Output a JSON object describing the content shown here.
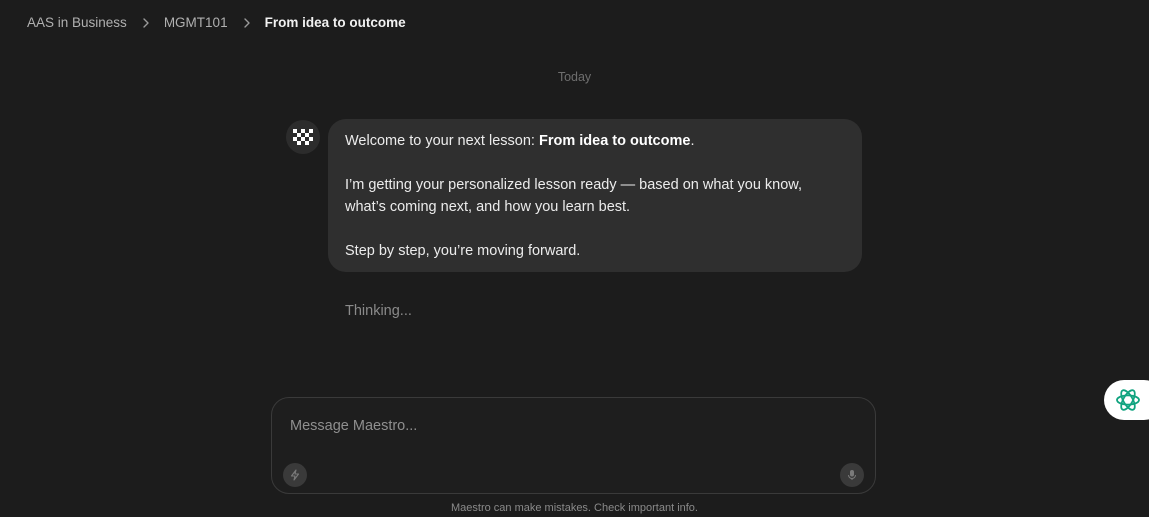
{
  "breadcrumb": {
    "items": [
      {
        "label": "AAS in Business"
      },
      {
        "label": "MGMT101"
      },
      {
        "label": "From idea to outcome"
      }
    ]
  },
  "chat": {
    "day_label": "Today",
    "assistant_icon": "checker-logo-icon",
    "message": {
      "line1_prefix": "Welcome to your next lesson: ",
      "line1_bold": "From idea to outcome",
      "line1_suffix": ".",
      "paragraph2": "I’m getting your personalized lesson ready — based on what you know, what’s coming next, and how you learn best.",
      "paragraph3": "Step by step, you’re moving forward."
    },
    "status": "Thinking..."
  },
  "composer": {
    "placeholder": "Message Maestro...",
    "left_icon": "lightning-icon",
    "right_icon": "microphone-icon"
  },
  "disclaimer": "Maestro can make mistakes. Check important info.",
  "floating_button": {
    "icon": "openai-knot-icon",
    "accent_color": "#10a37f"
  }
}
